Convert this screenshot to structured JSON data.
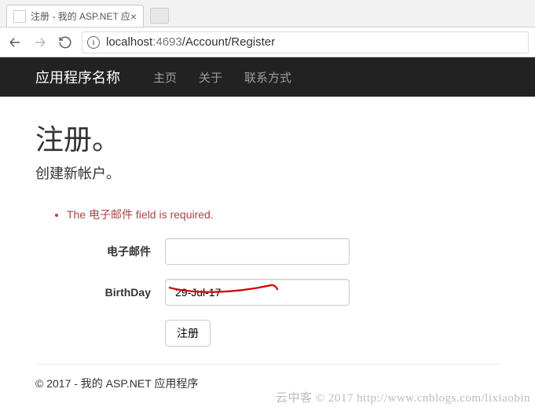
{
  "browser": {
    "tab_title": "注册 - 我的 ASP.NET 应",
    "url_host": "localhost",
    "url_port": ":4693",
    "url_path": "/Account/Register"
  },
  "navbar": {
    "brand": "应用程序名称",
    "links": {
      "home": "主页",
      "about": "关于",
      "contact": "联系方式"
    }
  },
  "page": {
    "title": "注册。",
    "subtitle": "创建新帐户。"
  },
  "validation": {
    "error_email_required": "The 电子邮件 field is required."
  },
  "form": {
    "email_label": "电子邮件",
    "email_value": "",
    "birthday_label": "BirthDay",
    "birthday_value": "29-Jul-17",
    "submit_label": "注册"
  },
  "footer": {
    "text": "© 2017 - 我的 ASP.NET 应用程序"
  },
  "watermark": {
    "text": "云中客 © 2017 http://www.cnblogs.com/lixiaobin"
  }
}
